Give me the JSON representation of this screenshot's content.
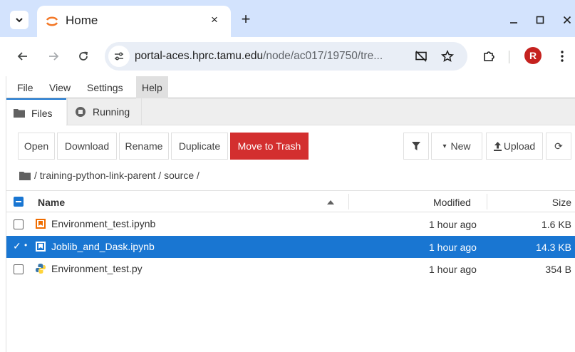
{
  "browser": {
    "tab_title": "Home",
    "tab_close_label": "×",
    "new_tab_label": "+",
    "url_host": "portal-aces.hprc.tamu.edu",
    "url_path": "/node/ac017/19750/tre...",
    "avatar_letter": "R"
  },
  "menu": {
    "items": [
      "File",
      "View",
      "Settings",
      "Help"
    ]
  },
  "side_tabs": {
    "files": "Files",
    "running": "Running"
  },
  "toolbar": {
    "open": "Open",
    "download": "Download",
    "rename": "Rename",
    "duplicate": "Duplicate",
    "move_to_trash": "Move to Trash",
    "new": "New",
    "new_prefix": "▾",
    "upload": "Upload",
    "refresh": "⟳"
  },
  "breadcrumb": {
    "path": "/ training-python-link-parent / source /"
  },
  "file_list": {
    "columns": {
      "name": "Name",
      "modified": "Modified",
      "size": "Size"
    },
    "rows": [
      {
        "name": "Environment_test.ipynb",
        "modified": "1 hour ago",
        "size": "1.6 KB",
        "type": "notebook-icon",
        "selected": false
      },
      {
        "name": "Joblib_and_Dask.ipynb",
        "modified": "1 hour ago",
        "size": "14.3 KB",
        "type": "notebook-icon",
        "selected": true
      },
      {
        "name": "Environment_test.py",
        "modified": "1 hour ago",
        "size": "354 B",
        "type": "python-icon",
        "selected": false
      }
    ]
  },
  "colors": {
    "accent": "#1976d2",
    "danger": "#d32f2f",
    "tabstrip": "#d3e3fd",
    "notebook_icon": "#ef6c00"
  }
}
